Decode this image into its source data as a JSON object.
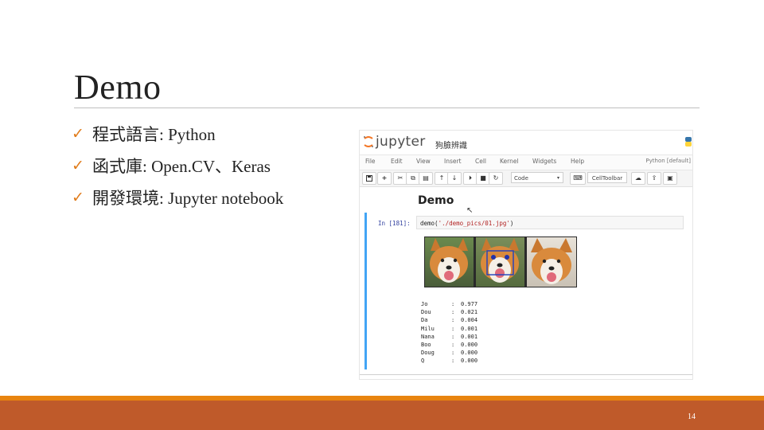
{
  "slide": {
    "title": "Demo",
    "bullets": [
      {
        "check": "ü",
        "text": "程式語言: Python"
      },
      {
        "check": "ü",
        "text": "函式庫: Open.CV、Keras"
      },
      {
        "check": "ü",
        "text": "開發環境: Jupyter notebook"
      }
    ],
    "page_number": "14",
    "accent_color": "#e8840f",
    "footer_color": "#bf5a2a"
  },
  "notebook": {
    "app_name": "jupyter",
    "notebook_name": "狗臉辨識",
    "menu": [
      "File",
      "Edit",
      "View",
      "Insert",
      "Cell",
      "Kernel",
      "Widgets",
      "Help"
    ],
    "kernel": "Python [default]",
    "toolbar": {
      "save_icon": "floppy-disk-icon",
      "add_icon": "plus",
      "cut_icon": "✂",
      "copy_icon": "⧉",
      "paste_icon": "📋",
      "up_icon": "↑",
      "down_icon": "↓",
      "run_icon": "⏭",
      "stop_icon": "■",
      "restart_icon": "↻",
      "cell_type": "Code",
      "cell_type_caret": "▾",
      "keyboard_icon": "⌨",
      "celltoolbar": "CellToolbar",
      "upload_icon": "☁",
      "publish_icon": "⇪",
      "present_icon": "▣"
    },
    "heading": "Demo",
    "cell": {
      "prompt": "In [181]:",
      "code_prefix": "demo(",
      "code_string": "'./demo_pics/01.jpg'",
      "code_suffix": ")"
    },
    "results": [
      {
        "name": "Jo",
        "sep": ":",
        "value": "0.977"
      },
      {
        "name": "Dou",
        "sep": ":",
        "value": "0.021"
      },
      {
        "name": "Da",
        "sep": ":",
        "value": "0.004"
      },
      {
        "name": "Milu",
        "sep": ":",
        "value": "0.001"
      },
      {
        "name": "Nana",
        "sep": ":",
        "value": "0.001"
      },
      {
        "name": "Boo",
        "sep": ":",
        "value": "0.000"
      },
      {
        "name": "Doug",
        "sep": ":",
        "value": "0.000"
      },
      {
        "name": "Q",
        "sep": ":",
        "value": "0.000"
      }
    ]
  }
}
